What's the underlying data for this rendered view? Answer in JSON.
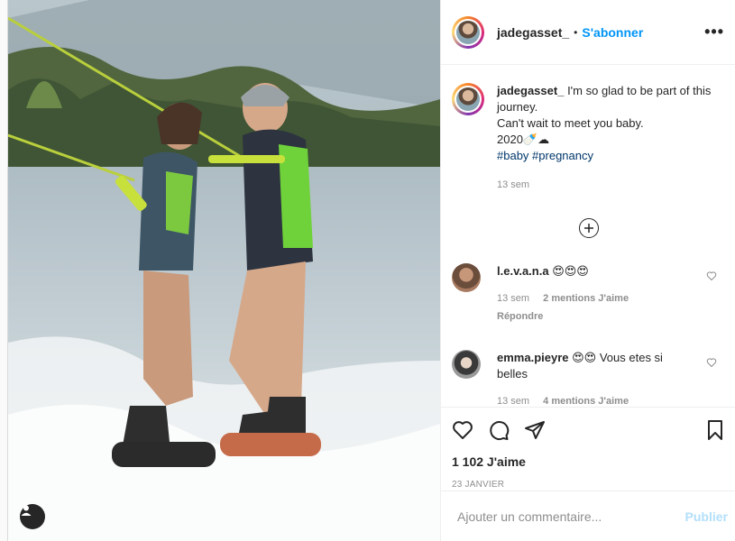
{
  "post": {
    "username": "jadegasset_",
    "dot": "•",
    "follow_label": "S'abonner",
    "more_label": "•••"
  },
  "caption": {
    "username": "jadegasset_",
    "line1": "I'm so glad to be part of this journey.",
    "line2": "Can't wait to meet you baby.",
    "line3": "2020🍼☁",
    "hashtag1": "#baby",
    "hashtag2": "#pregnancy",
    "time": "13 sem"
  },
  "comments": [
    {
      "username": "l.e.v.a.n.a",
      "text": "😍😍😍",
      "time": "13 sem",
      "likes": "2 mentions J'aime",
      "reply": "Répondre"
    },
    {
      "username": "emma.pieyre",
      "text": "😍😍 Vous etes si belles",
      "time": "13 sem",
      "likes": "4 mentions J'aime"
    }
  ],
  "footer": {
    "likes": "1 102 J'aime",
    "date": "23 JANVIER",
    "comment_placeholder": "Ajouter un commentaire...",
    "post_label": "Publier"
  },
  "colors": {
    "accent": "#0095f6",
    "hashtag": "#00376b",
    "muted": "#8e8e8e"
  }
}
